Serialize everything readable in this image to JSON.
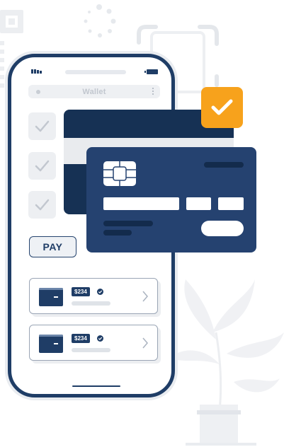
{
  "wallet_bar": {
    "title": "Wallet"
  },
  "actions": {
    "pay_label": "PAY"
  },
  "transactions": [
    {
      "amount": "$234"
    },
    {
      "amount": "$234"
    }
  ],
  "colors": {
    "navy": "#1f3d66",
    "card_front": "#254270",
    "card_back": "#163154",
    "accent": "#f7a21c"
  },
  "icons": [
    "signal-icon",
    "battery-icon",
    "more-icon",
    "check-icon",
    "wallet-icon",
    "verified-icon",
    "chevron-right-icon",
    "chip-icon",
    "checkmark-badge-icon"
  ]
}
